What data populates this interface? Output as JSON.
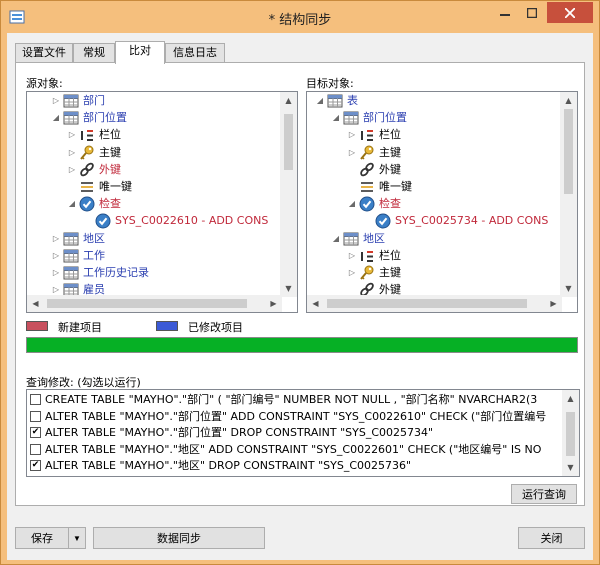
{
  "window": {
    "title": "* 结构同步"
  },
  "tabs": [
    {
      "label": "设置文件"
    },
    {
      "label": "常规"
    },
    {
      "label": "比对"
    },
    {
      "label": "信息日志"
    }
  ],
  "source": {
    "label": "源对象:",
    "rows": [
      {
        "arrow": "▷",
        "icon": "table-icon",
        "text": "部门",
        "color": "blue"
      },
      {
        "arrow": "◢",
        "icon": "table-icon",
        "text": "部门位置",
        "color": "blue"
      },
      {
        "arrow": "▷",
        "icon": "columns-icon",
        "text": "栏位",
        "color": "black"
      },
      {
        "arrow": "▷",
        "icon": "primary-key-icon",
        "text": "主键",
        "color": "black"
      },
      {
        "arrow": "▷",
        "icon": "foreign-key-icon",
        "text": "外键",
        "color": "red"
      },
      {
        "arrow": "",
        "icon": "unique-key-icon",
        "text": "唯一键",
        "color": "black"
      },
      {
        "arrow": "◢",
        "icon": "check-icon",
        "text": "检查",
        "color": "red"
      },
      {
        "arrow": "",
        "icon": "check-icon",
        "text": "SYS_C0022610 - ADD CONS",
        "color": "red"
      },
      {
        "arrow": "▷",
        "icon": "table-icon",
        "text": "地区",
        "color": "blue"
      },
      {
        "arrow": "▷",
        "icon": "table-icon",
        "text": "工作",
        "color": "blue"
      },
      {
        "arrow": "▷",
        "icon": "table-icon",
        "text": "工作历史记录",
        "color": "blue"
      },
      {
        "arrow": "▷",
        "icon": "table-icon",
        "text": "雇员",
        "color": "blue"
      }
    ]
  },
  "target": {
    "label": "目标对象:",
    "rows": [
      {
        "arrow": "◢",
        "icon": "table-icon",
        "text": "表",
        "color": "blue"
      },
      {
        "arrow": "◢",
        "icon": "table-icon",
        "text": "部门位置",
        "color": "blue"
      },
      {
        "arrow": "▷",
        "icon": "columns-icon",
        "text": "栏位",
        "color": "black"
      },
      {
        "arrow": "▷",
        "icon": "primary-key-icon",
        "text": "主键",
        "color": "black"
      },
      {
        "arrow": "",
        "icon": "foreign-key-icon",
        "text": "外键",
        "color": "black"
      },
      {
        "arrow": "",
        "icon": "unique-key-icon",
        "text": "唯一键",
        "color": "black"
      },
      {
        "arrow": "◢",
        "icon": "check-icon",
        "text": "检查",
        "color": "red"
      },
      {
        "arrow": "",
        "icon": "check-icon",
        "text": "SYS_C0025734 - ADD CONS",
        "color": "red"
      },
      {
        "arrow": "◢",
        "icon": "table-icon",
        "text": "地区",
        "color": "blue"
      },
      {
        "arrow": "▷",
        "icon": "columns-icon",
        "text": "栏位",
        "color": "black"
      },
      {
        "arrow": "▷",
        "icon": "primary-key-icon",
        "text": "主键",
        "color": "black"
      },
      {
        "arrow": "",
        "icon": "foreign-key-icon",
        "text": "外键",
        "color": "black"
      }
    ]
  },
  "legend": {
    "new_label": "新建项目",
    "new_color": "#c8505e",
    "modified_label": "已修改项目",
    "modified_color": "#3c5ad6"
  },
  "progress": 1.0,
  "query": {
    "label": "查询修改: (勾选以运行)",
    "items": [
      {
        "checked": false,
        "text": "CREATE TABLE \"MAYHO\".\"部门\" ( \"部门编号\" NUMBER NOT NULL , \"部门名称\" NVARCHAR2(3"
      },
      {
        "checked": false,
        "text": "ALTER TABLE \"MAYHO\".\"部门位置\" ADD CONSTRAINT \"SYS_C0022610\" CHECK (\"部门位置编号"
      },
      {
        "checked": true,
        "text": "ALTER TABLE \"MAYHO\".\"部门位置\" DROP CONSTRAINT \"SYS_C0025734\""
      },
      {
        "checked": false,
        "text": "ALTER TABLE \"MAYHO\".\"地区\" ADD CONSTRAINT \"SYS_C0022601\" CHECK (\"地区编号\" IS NO"
      },
      {
        "checked": true,
        "text": "ALTER TABLE \"MAYHO\".\"地区\" DROP CONSTRAINT \"SYS_C0025736\""
      }
    ]
  },
  "buttons": {
    "run_query": "运行查询",
    "save": "保存",
    "sync": "数据同步",
    "close": "关闭"
  }
}
